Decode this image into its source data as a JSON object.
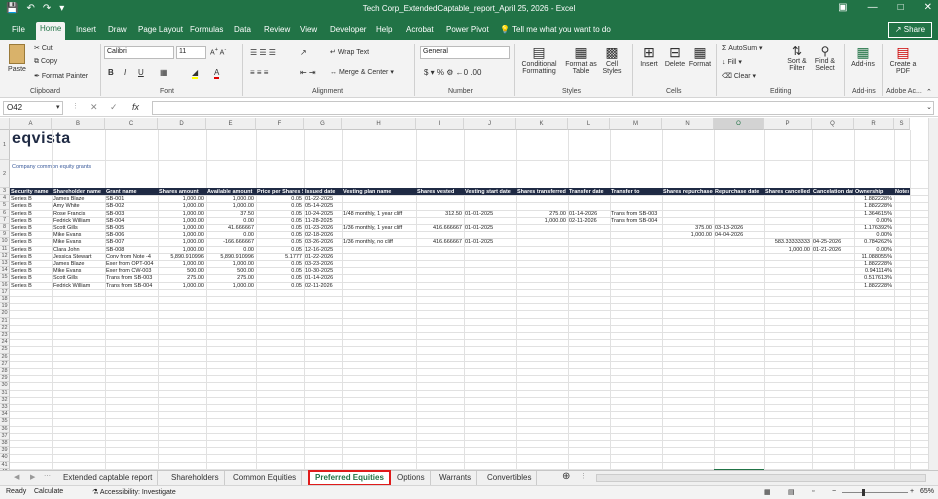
{
  "titlebar": {
    "autosave": "",
    "title": "Tech Corp_ExtendedCaptable_report_April 25, 2026  -  Excel"
  },
  "tabs": [
    "File",
    "Home",
    "Insert",
    "Draw",
    "Page Layout",
    "Formulas",
    "Data",
    "Review",
    "View",
    "Developer",
    "Help",
    "Acrobat",
    "Power Pivot"
  ],
  "tell_me": "Tell me what you want to do",
  "share": "Share",
  "ribbon": {
    "clipboard": {
      "paste": "Paste",
      "cut": "Cut",
      "copy": "Copy",
      "format_painter": "Format Painter",
      "label": "Clipboard"
    },
    "font": {
      "name": "Calibri",
      "size": "11",
      "label": "Font"
    },
    "alignment": {
      "wrap": "Wrap Text",
      "merge": "Merge & Center",
      "label": "Alignment"
    },
    "number": {
      "format": "General",
      "label": "Number"
    },
    "styles": {
      "cond": "Conditional Formatting",
      "table": "Format as Table",
      "cell": "Cell Styles",
      "label": "Styles"
    },
    "cells": {
      "insert": "Insert",
      "delete": "Delete",
      "format": "Format",
      "label": "Cells"
    },
    "editing": {
      "autosum": "AutoSum",
      "fill": "Fill",
      "clear": "Clear",
      "sort": "Sort & Filter",
      "find": "Find & Select",
      "label": "Editing"
    },
    "addins": {
      "addins": "Add-ins",
      "label": "Add-ins"
    },
    "adobe": {
      "create": "Create a PDF",
      "label": "Adobe Ac..."
    }
  },
  "namebox": "O42",
  "columns": [
    "A",
    "B",
    "C",
    "D",
    "E",
    "F",
    "G",
    "H",
    "I",
    "J",
    "K",
    "L",
    "M",
    "N",
    "O",
    "P",
    "Q",
    "R",
    "S"
  ],
  "logo": "eqvista",
  "subtitle": "Company common equity grants",
  "headers": [
    "Security name",
    "Shareholder name",
    "Grant name",
    "Shares amount",
    "Available amount",
    "Price per Shares $",
    "Issued date",
    "Vesting plan name",
    "Shares vested",
    "Vesting start date",
    "Shares transferred",
    "Transfer date",
    "Transfer to",
    "Shares repurchased",
    "Repurchase date",
    "Shares cancelled",
    "Cancelation date",
    "Ownership",
    "Notes"
  ],
  "rows": [
    [
      "Series B",
      "James Blaze",
      "SB-001",
      "1,000.00",
      "1,000.00",
      "0.05",
      "01-22-2025",
      "",
      "",
      "",
      "",
      "",
      "",
      "",
      "",
      "",
      "",
      "1.882228%",
      ""
    ],
    [
      "Series B",
      "Amy White",
      "SB-002",
      "1,000.00",
      "1,000.00",
      "0.05",
      "05-14-2025",
      "",
      "",
      "",
      "",
      "",
      "",
      "",
      "",
      "",
      "",
      "1.882228%",
      ""
    ],
    [
      "Series B",
      "Rose Francis",
      "SB-003",
      "1,000.00",
      "37.50",
      "0.05",
      "10-24-2025",
      "1/48 monthly, 1 year cliff",
      "312.50",
      "01-01-2025",
      "275.00",
      "01-14-2026",
      "Trans from SB-003",
      "",
      "",
      "",
      "",
      "1.364615%",
      ""
    ],
    [
      "Series B",
      "Fedrick William",
      "SB-004",
      "1,000.00",
      "0.00",
      "0.05",
      "11-28-2025",
      "",
      "",
      "",
      "1,000.00",
      "02-11-2026",
      "Trans from SB-004",
      "",
      "",
      "",
      "",
      "0.00%",
      ""
    ],
    [
      "Series B",
      "Scott Gills",
      "SB-005",
      "1,000.00",
      "41.666667",
      "0.05",
      "01-23-2026",
      "1/36 monthly, 1 year cliff",
      "416.666667",
      "01-01-2025",
      "",
      "",
      "",
      "375.00",
      "03-13-2026",
      "",
      "",
      "1.176392%",
      ""
    ],
    [
      "Series B",
      "Mike Evans",
      "SB-006",
      "1,000.00",
      "0.00",
      "0.05",
      "02-18-2026",
      "",
      "",
      "",
      "",
      "",
      "",
      "1,000.00",
      "04-04-2026",
      "",
      "",
      "0.00%",
      ""
    ],
    [
      "Series B",
      "Mike Evans",
      "SB-007",
      "1,000.00",
      "-166.666667",
      "0.05",
      "03-26-2026",
      "1/36 monthly, no cliff",
      "416.666667",
      "01-01-2025",
      "",
      "",
      "",
      "",
      "",
      "583.33333333",
      "04-25-2026",
      "0.784262%",
      ""
    ],
    [
      "Series B",
      "Clara John",
      "SB-008",
      "1,000.00",
      "0.00",
      "0.05",
      "12-16-2025",
      "",
      "",
      "",
      "",
      "",
      "",
      "",
      "",
      "1,000.00",
      "01-21-2026",
      "0.00%",
      ""
    ],
    [
      "Series B",
      "Jessica Stewart",
      "Conv from Note -4",
      "5,890.910996",
      "5,890.910996",
      "5.1777",
      "01-22-2026",
      "",
      "",
      "",
      "",
      "",
      "",
      "",
      "",
      "",
      "",
      "11.088055%",
      ""
    ],
    [
      "Series B",
      "James Blaze",
      "Exer from OPT-004",
      "1,000.00",
      "1,000.00",
      "0.05",
      "03-23-2026",
      "",
      "",
      "",
      "",
      "",
      "",
      "",
      "",
      "",
      "",
      "1.882228%",
      ""
    ],
    [
      "Series B",
      "Mike Evans",
      "Exer from CW-003",
      "500.00",
      "500.00",
      "0.05",
      "10-30-2025",
      "",
      "",
      "",
      "",
      "",
      "",
      "",
      "",
      "",
      "",
      "0.941114%",
      ""
    ],
    [
      "Series B",
      "Scott Gills",
      "Trans from SB-003",
      "275.00",
      "275.00",
      "0.05",
      "01-14-2026",
      "",
      "",
      "",
      "",
      "",
      "",
      "",
      "",
      "",
      "",
      "0.517613%",
      ""
    ],
    [
      "Series B",
      "Fedrick William",
      "Trans from SB-004",
      "1,000.00",
      "1,000.00",
      "0.05",
      "02-11-2026",
      "",
      "",
      "",
      "",
      "",
      "",
      "",
      "",
      "",
      "",
      "1.882228%",
      ""
    ]
  ],
  "sheets": [
    "Extended captable report",
    "Shareholders",
    "Common Equities",
    "Preferred Equities",
    "Options",
    "Warrants",
    "Convertibles"
  ],
  "active_sheet": "Preferred Equities",
  "status": {
    "ready": "Ready",
    "calculate": "Calculate",
    "accessibility": "Accessibility: Investigate",
    "zoom": "65%"
  }
}
